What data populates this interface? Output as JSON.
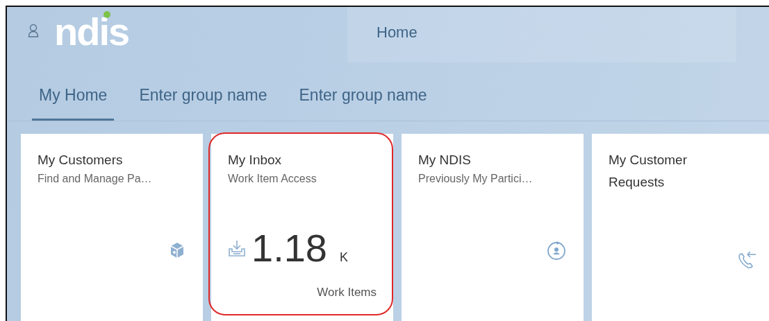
{
  "header": {
    "logo": "ndis",
    "title": "Home"
  },
  "tabs": [
    {
      "label": "My Home",
      "selected": true
    },
    {
      "label": "Enter group name",
      "selected": false
    },
    {
      "label": "Enter group name",
      "selected": false
    }
  ],
  "tiles": [
    {
      "kind": "launch",
      "title": "My Customers",
      "subtitle": "Find and Manage Pa…",
      "highlighted": false
    },
    {
      "kind": "kpi",
      "title": "My Inbox",
      "subtitle": "Work Item Access",
      "value": "1.18",
      "unit": "K",
      "footer": "Work Items",
      "highlighted": true
    },
    {
      "kind": "launch",
      "title": "My NDIS",
      "subtitle": "Previously My Partici…",
      "highlighted": false
    },
    {
      "kind": "launch",
      "title": "My Customer Requests",
      "highlighted": false
    }
  ]
}
